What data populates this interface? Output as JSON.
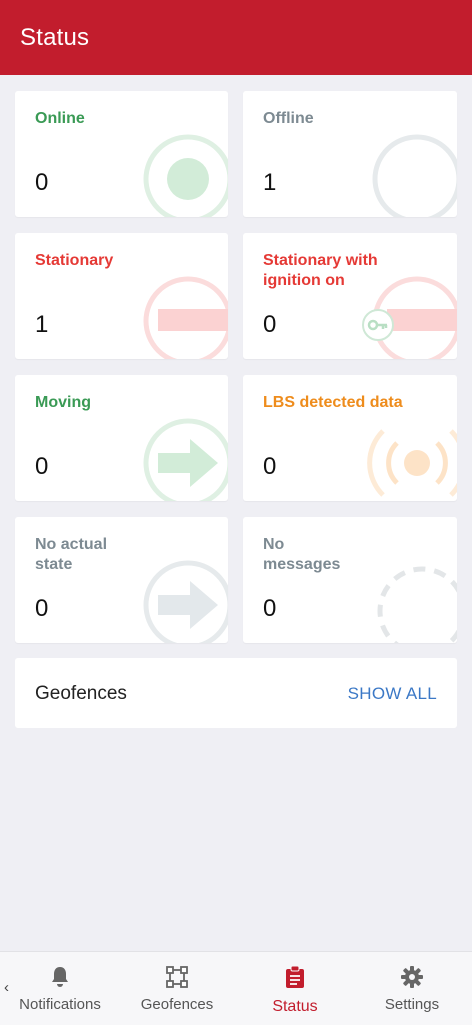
{
  "header": {
    "title": "Status"
  },
  "cards": [
    {
      "label": "Online",
      "count": "0",
      "color": "#3a9a55"
    },
    {
      "label": "Offline",
      "count": "1",
      "color": "#7d8a92"
    },
    {
      "label": "Stationary",
      "count": "1",
      "color": "#e53935"
    },
    {
      "label": "Stationary with ignition on",
      "count": "0",
      "color": "#e53935"
    },
    {
      "label": "Moving",
      "count": "0",
      "color": "#3a9a55"
    },
    {
      "label": "LBS detected data",
      "count": "0",
      "color": "#ee8c1c"
    },
    {
      "label": "No actual state",
      "count": "0",
      "color": "#7d8a92"
    },
    {
      "label": "No messages",
      "count": "0",
      "color": "#7d8a92"
    }
  ],
  "geofences": {
    "title": "Geofences",
    "action": "SHOW ALL"
  },
  "nav": {
    "back_glyph": "‹",
    "items": [
      {
        "label": "Notifications",
        "icon": "bell-icon"
      },
      {
        "label": "Geofences",
        "icon": "geofence-icon"
      },
      {
        "label": "Status",
        "icon": "clipboard-icon",
        "active": true
      },
      {
        "label": "Settings",
        "icon": "gear-icon"
      }
    ]
  },
  "colors": {
    "brand": "#c21d2d",
    "link": "#3b78c6",
    "background": "#efeff4"
  }
}
